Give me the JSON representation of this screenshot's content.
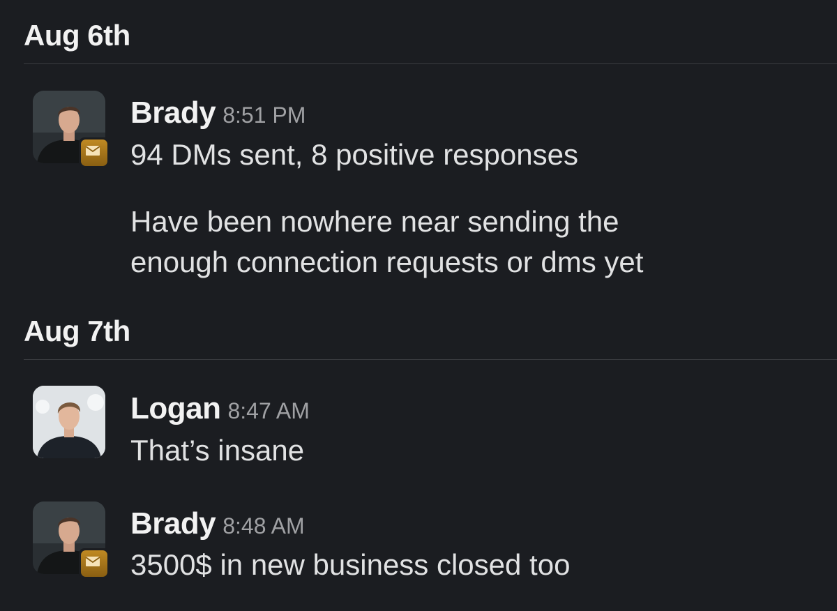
{
  "days": [
    {
      "label": "Aug 6th",
      "messages": [
        {
          "author": "Brady",
          "time": "8:51 PM",
          "avatar": "brady-avatar",
          "status_icon": "envelope-icon",
          "lines": [
            "94 DMs sent, 8 positive responses",
            "Have been nowhere near sending the",
            "enough connection requests or dms yet"
          ]
        }
      ]
    },
    {
      "label": "Aug 7th",
      "messages": [
        {
          "author": "Logan",
          "time": "8:47 AM",
          "avatar": "logan-avatar",
          "lines": [
            "That’s insane"
          ]
        },
        {
          "author": "Brady",
          "time": "8:48 AM",
          "avatar": "brady-avatar",
          "status_icon": "envelope-icon",
          "lines": [
            "3500$ in new business closed too"
          ]
        }
      ]
    }
  ],
  "colors": {
    "background": "#1b1d21",
    "divider": "#3a3c41",
    "author": "#f2f2f2",
    "text": "#e1e2e3",
    "timestamp": "#a0a1a4",
    "status_badge": "#b07d1f"
  }
}
